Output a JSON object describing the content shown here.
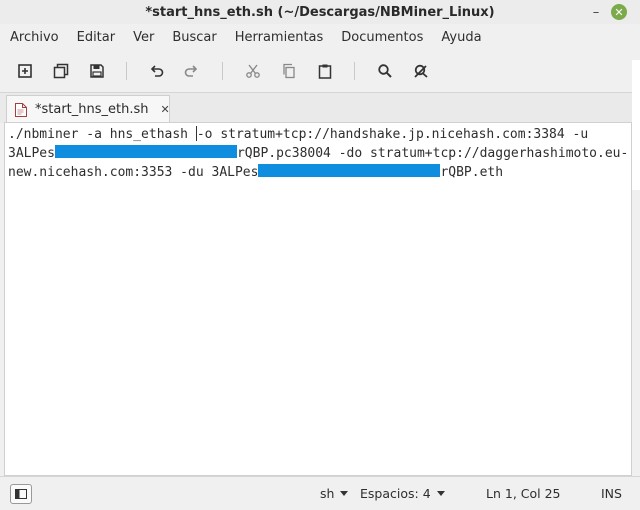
{
  "window": {
    "title": "*start_hns_eth.sh (~/Descargas/NBMiner_Linux)",
    "minimize_glyph": "–",
    "close_glyph": "✕"
  },
  "menubar": {
    "items": [
      "Archivo",
      "Editar",
      "Ver",
      "Buscar",
      "Herramientas",
      "Documentos",
      "Ayuda"
    ]
  },
  "toolbar": {
    "icons": [
      "new-document-icon",
      "new-window-icon",
      "save-icon",
      "undo-icon",
      "redo-icon",
      "cut-icon",
      "copy-icon",
      "paste-icon",
      "search-icon",
      "replace-icon"
    ]
  },
  "tabs": [
    {
      "label": "*start_hns_eth.sh",
      "close_glyph": "✕"
    }
  ],
  "editor": {
    "line1_a": "./nbminer -a hns_ethash ",
    "line1_b": "-o stratum+tcp://handshake.jp.nicehash.com:3384 -u",
    "line2_a": "3ALPes",
    "line2_b": "rQBP.pc38004 -do stratum+tcp://daggerhashimoto.eu-",
    "line3_a": "new.nicehash.com:3353 -du 3ALPes",
    "line3_b": "rQBP.eth",
    "redaction_color": "#0f8ee0"
  },
  "statusbar": {
    "language": "sh",
    "tab_width": "Espacios: 4",
    "position": "Ln 1, Col 25",
    "mode": "INS"
  }
}
